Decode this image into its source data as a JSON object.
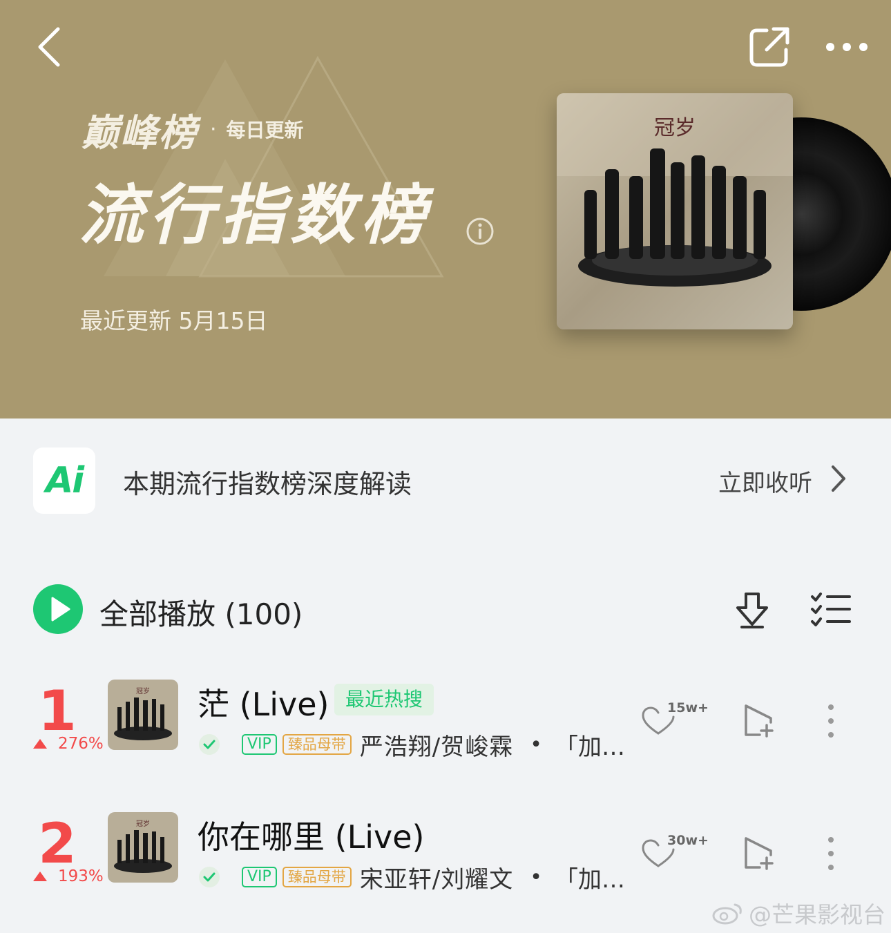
{
  "header": {
    "brand": "巅峰榜",
    "brand_separator": "·",
    "brand_sub": "每日更新",
    "title": "流行指数榜",
    "update_text": "最近更新 5月15日",
    "background_color": "#a9996f"
  },
  "icons": {
    "back": "chevron-left-icon",
    "share": "share-external-icon",
    "more": "more-horizontal-icon",
    "info": "info-icon",
    "download": "download-icon",
    "multi_select": "multi-select-list-icon",
    "like": "heart-icon",
    "add": "add-to-playlist-icon",
    "more_vert": "more-vertical-icon"
  },
  "ai_bar": {
    "logo": "Ai",
    "text": "本期流行指数榜深度解读",
    "action": "立即收听"
  },
  "play_all": {
    "label": "全部播放",
    "count": "(100)"
  },
  "songs": [
    {
      "rank": "1",
      "trend": "276%",
      "title": "茫 (Live)",
      "tag": "最近热搜",
      "vip": "VIP",
      "master": "臻品母带",
      "artists": "严浩翔/贺峻霖",
      "separator": "•",
      "album": "「加…",
      "likes": "15w+"
    },
    {
      "rank": "2",
      "trend": "193%",
      "title": "你在哪里 (Live)",
      "tag": "",
      "vip": "VIP",
      "master": "臻品母带",
      "artists": "宋亚轩/刘耀文",
      "separator": "•",
      "album": "「加…",
      "likes": "30w+"
    }
  ],
  "watermark": "@芒果影视台",
  "colors": {
    "accent_green": "#1ec773",
    "rank_red": "#f24a4a",
    "master_gold": "#e3a644"
  }
}
